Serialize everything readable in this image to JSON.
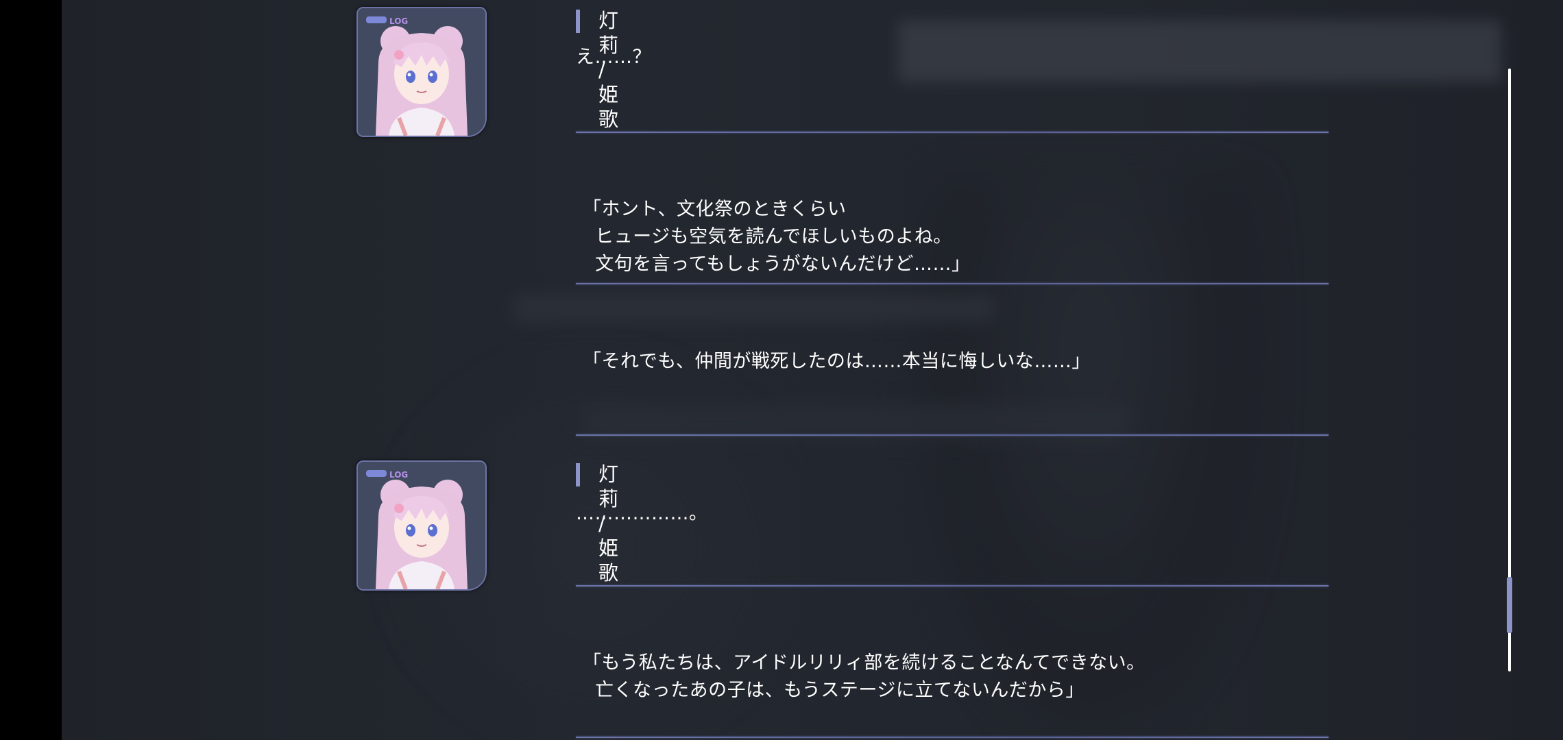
{
  "log": {
    "entries": [
      {
        "speaker": "灯莉 / 姫歌",
        "text": "え……？"
      },
      {
        "speaker": "",
        "text": "「ホント、文化祭のときくらい\n  ヒュージも空気を読んでほしいものよね。\n  文句を言ってもしょうがないんだけど……」"
      },
      {
        "speaker": "",
        "text": "「それでも、仲間が戦死したのは……本当に悔しいな……」"
      },
      {
        "speaker": "灯莉 / 姫歌",
        "text": "………………。"
      },
      {
        "speaker": "",
        "text": "「もう私たちは、アイドルリリィ部を続けることなんてできない。\n  亡くなったあの子は、もうステージに立てないんだから」"
      }
    ],
    "portrait_badge": "LOG",
    "portrait_icon": "character-portrait-icon"
  },
  "scroll": {
    "position_fraction": 0.93
  },
  "colors": {
    "accent": "#8d94c9",
    "divider": "#6b74a8",
    "background": "#22262d",
    "text": "#ffffff"
  }
}
